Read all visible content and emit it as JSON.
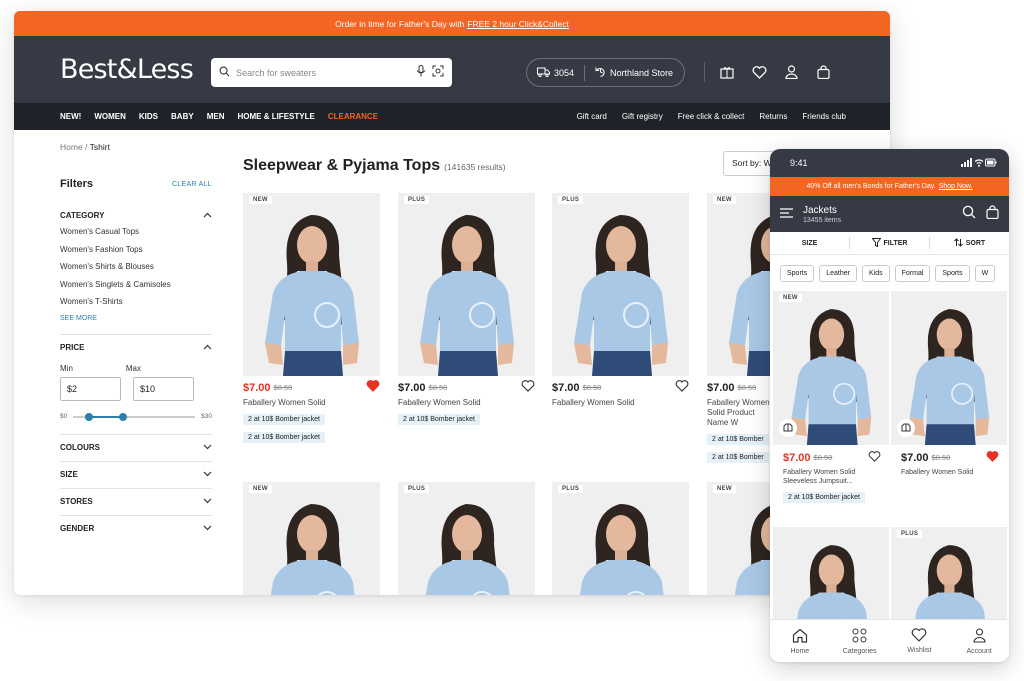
{
  "desktop": {
    "promo": {
      "text": "Order in time for Father's Day with",
      "link": "FREE 2 hour Click&Collect"
    },
    "logo": "Best&Less",
    "search": {
      "placeholder": "Search for sweaters"
    },
    "store": {
      "delivery_code": "3054",
      "store_name": "Northland Store"
    },
    "header_icons": [
      "gift-card-icon",
      "heart-icon",
      "user-icon",
      "bag-icon"
    ],
    "nav": {
      "left": [
        "NEW!",
        "WOMEN",
        "KIDS",
        "BABY",
        "MEN",
        "HOME & LIFESTYLE"
      ],
      "clearance": "CLEARANCE",
      "right": [
        "Gift card",
        "Gift registry",
        "Free click & collect",
        "Returns",
        "Friends club"
      ]
    },
    "breadcrumb": {
      "home": "Home",
      "sep": " / ",
      "current": "Tshirt"
    },
    "filters": {
      "title": "Filters",
      "clear_all": "CLEAR ALL",
      "category": {
        "label": "CATEGORY",
        "items": [
          "Women's Casual Tops",
          "Women's Fashion Tops",
          "Women's Shirts & Blouses",
          "Women's Singlets & Camisoles",
          "Women's T-Shirts"
        ],
        "see_more": "SEE MORE"
      },
      "price": {
        "label": "PRICE",
        "min_label": "Min",
        "max_label": "Max",
        "min_value": "$2",
        "max_value": "$10",
        "range_min": "$0",
        "range_max": "$30"
      },
      "collapsed": [
        "COLOURS",
        "SIZE",
        "STORES",
        "GENDER"
      ]
    },
    "page_title": "Sleepwear & Pyjama Tops",
    "result_count": "(141635 results)",
    "sort_label": "Sort by: W",
    "products": [
      {
        "badge": "NEW",
        "price": "$7.00",
        "was": "$8.50",
        "sale": true,
        "wishlisted": true,
        "name": "Faballery Women Solid",
        "tags": [
          "2 at 10$ Bomber jacket",
          "2 at 10$ Bomber jacket"
        ]
      },
      {
        "badge": "PLUS",
        "price": "$7.00",
        "was": "$8.50",
        "sale": false,
        "wishlisted": false,
        "name": "Faballery Women Solid",
        "tags": [
          "2 at 10$ Bomber jacket"
        ]
      },
      {
        "badge": "PLUS",
        "price": "$7.00",
        "was": "$8.50",
        "sale": false,
        "wishlisted": false,
        "name": "Faballery Women Solid",
        "tags": []
      },
      {
        "badge": "NEW",
        "price": "$7.00",
        "was": "$8.50",
        "sale": false,
        "wishlisted": false,
        "name": "Faballery Women Solid Product Name W",
        "tags": [
          "2 at 10$ Bomber",
          "2 at 10$ Bomber"
        ]
      },
      {
        "badge": "NEW"
      },
      {
        "badge": "PLUS"
      },
      {
        "badge": "PLUS"
      },
      {
        "badge": "NEW"
      }
    ]
  },
  "mobile": {
    "time": "9:41",
    "promo": {
      "text": "40% Off all men's Bonds for Father's Day.",
      "link": "Shop Now."
    },
    "title": "Jackets",
    "subtitle": "13455 items",
    "toolbar": [
      "SIZE",
      "FILTER",
      "SORT"
    ],
    "chips": [
      "Sports",
      "Leather",
      "Kids",
      "Formal",
      "Sports",
      "W"
    ],
    "products": [
      {
        "badge": "NEW",
        "price": "$7.00",
        "was": "$8.50",
        "sale": true,
        "wishlisted": false,
        "name": "Faballery Women Solid Sleeveless Jumpsuit...",
        "tags": [
          "2 at 10$ Bomber jacket"
        ]
      },
      {
        "badge": "",
        "price": "$7.00",
        "was": "$8.50",
        "sale": false,
        "wishlisted": true,
        "name": "Faballery Women Solid",
        "tags": []
      },
      {
        "badge": ""
      },
      {
        "badge": "PLUS"
      }
    ],
    "tabs": [
      "Home",
      "Categories",
      "Wishlist",
      "Account"
    ]
  },
  "colors": {
    "accent": "#f26522",
    "header": "#353a45",
    "nav": "#1f2228",
    "sale": "#e63223",
    "link": "#2b7fa8",
    "tag_bg": "#e5f1f8",
    "shirt": "#a9c8e6"
  }
}
